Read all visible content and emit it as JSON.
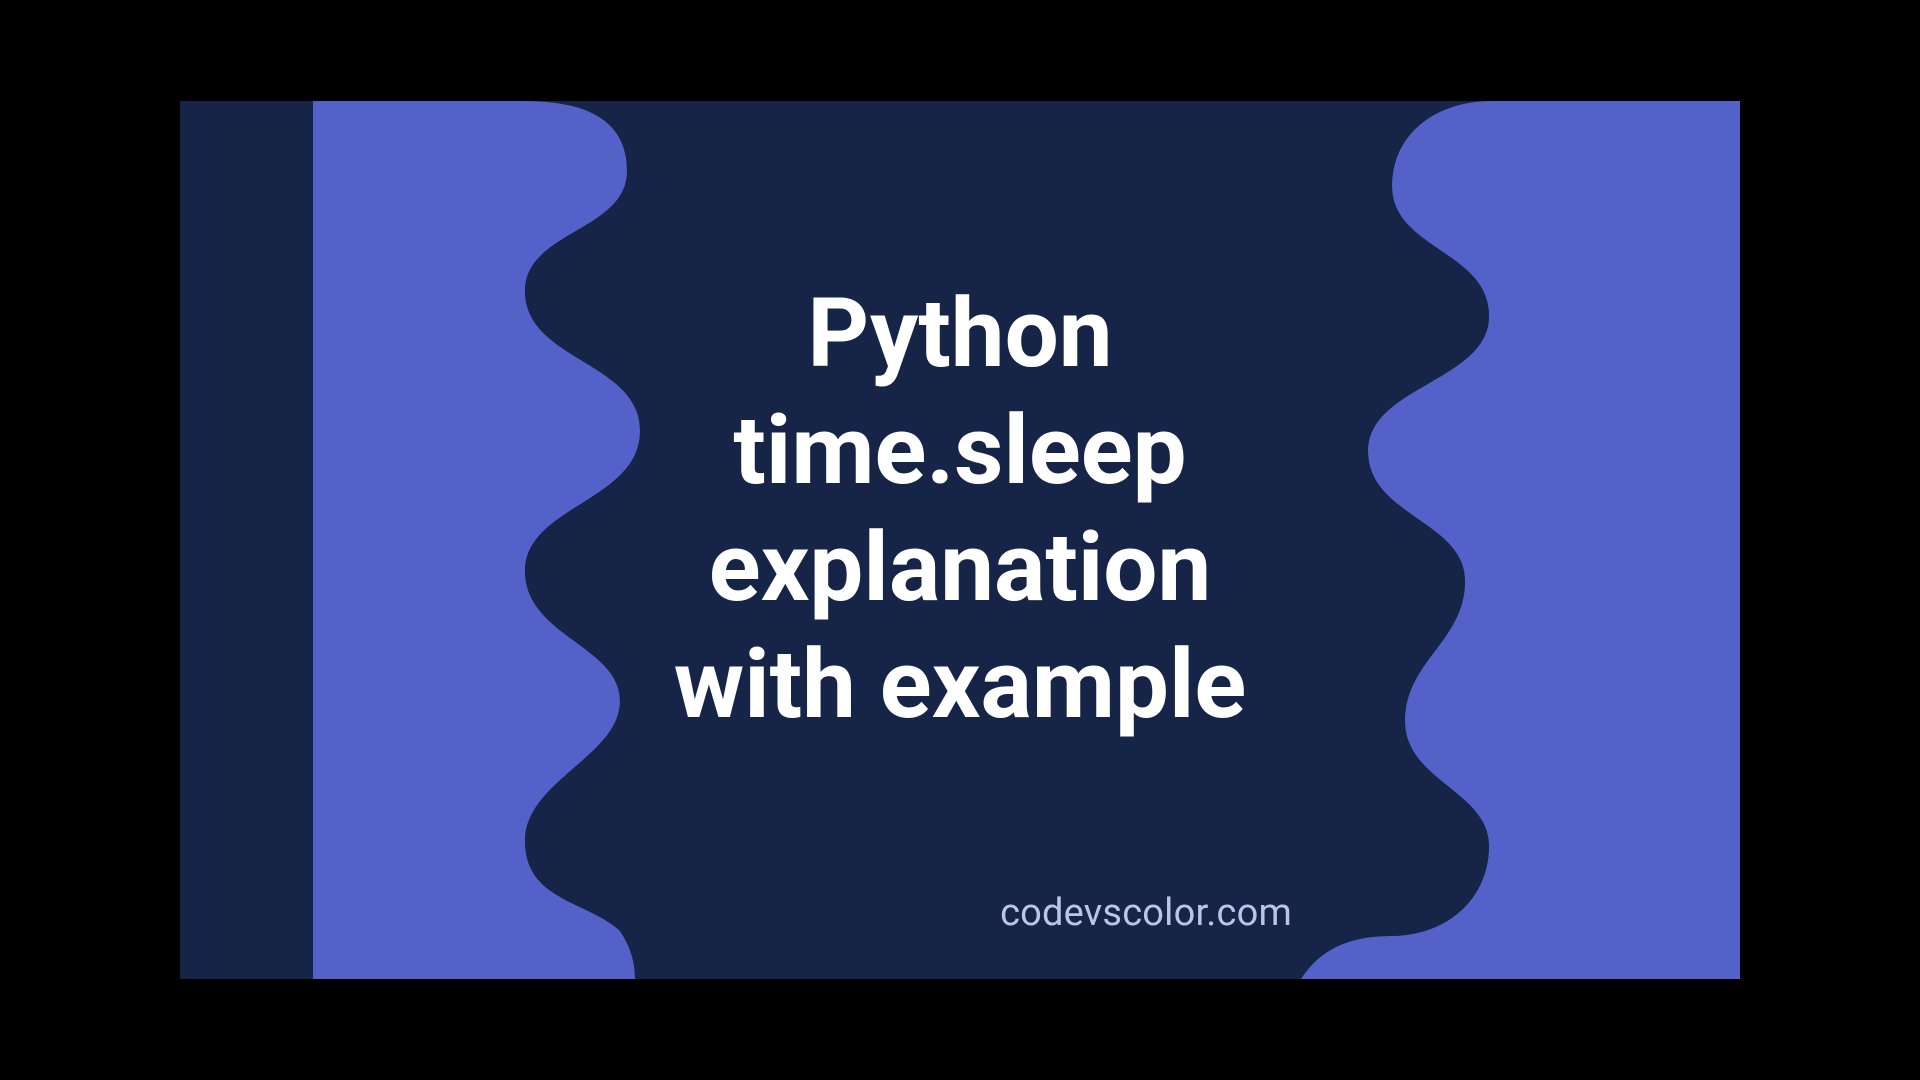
{
  "colors": {
    "bg_light": "#5461c8",
    "blob_dark": "#162447",
    "text": "#ffffff",
    "watermark": "#bcc5e6"
  },
  "title_text": "Python\ntime.sleep\nexplanation\nwith example",
  "watermark_text": "codevscolor.com"
}
